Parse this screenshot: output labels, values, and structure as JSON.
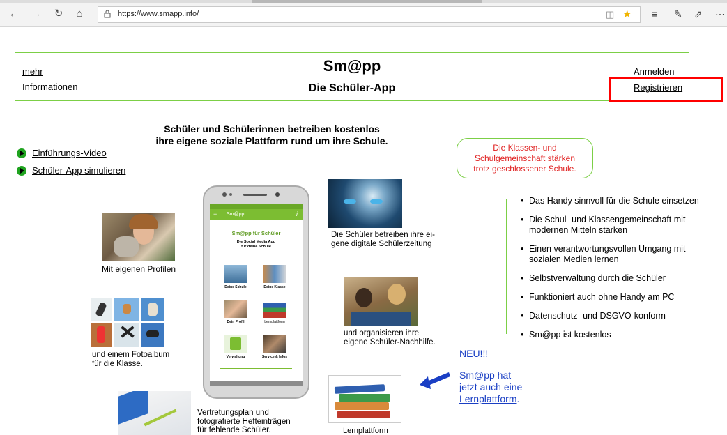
{
  "browser": {
    "url": "https://www.smapp.info/"
  },
  "header": {
    "title": "Sm@pp",
    "subtitle": "Die Schüler-App",
    "left_links": [
      "mehr",
      "Informationen"
    ],
    "login": "Anmelden",
    "register": "Registrieren"
  },
  "intro": {
    "line1": "Schüler und Schülerinnen betreiben kostenlos",
    "line2": "ihre eigene soziale Plattform rund um ihre Schule."
  },
  "side_links": [
    "Einführungs-Video",
    "Schüler-App simulieren"
  ],
  "callout": {
    "line1": "Die Klassen- und",
    "line2": "Schulgemeinschaft stärken",
    "line3": "trotz geschlossener Schule."
  },
  "captions": {
    "profiles": "Mit eigenen Profilen",
    "album1": "und einem Fotoalbum",
    "album2": "für die Klasse.",
    "newspaper1": "Die Schüler betreiben ihre ei-",
    "newspaper2": "gene digitale Schülerzeitung",
    "tutoring1": "und organisieren ihre",
    "tutoring2": "eigene Schüler-Nachhilfe.",
    "plan1": "Vertretungsplan und",
    "plan2": "fotografierte Hefteinträgen",
    "plan3": "für fehlende Schüler.",
    "lernplattform": "Lernplattform"
  },
  "phone": {
    "appbar": "Sm@pp",
    "heading": "Sm@pp für Schüler",
    "sub1": "Die Social Media App",
    "sub2": "für deine Schule",
    "tiles": [
      "Deine Schule",
      "Deine Klasse",
      "Dein Profil",
      "Lernplattform",
      "Verwaltung",
      "Service & Infos"
    ]
  },
  "bullets": [
    "Das Handy sinnvoll für die Schule einsetzen",
    "Die Schul- und Klassengemeinschaft mit modernen Mitteln stärken",
    "Einen verantwortungsvollen Umgang mit sozialen Medien lernen",
    "Selbstverwaltung durch die Schüler",
    "Funktioniert auch ohne Handy am PC",
    "Datenschutz- und DSGVO-konform",
    "Sm@pp ist kostenlos"
  ],
  "news": {
    "tag": "NEU!!!",
    "line1": "Sm@pp hat",
    "line2": "jetzt auch eine",
    "link": "Lernplattform",
    "dot": "."
  },
  "colors": {
    "accent_green": "#7ccf46",
    "callout_red": "#e02020",
    "news_blue": "#1a3fc4",
    "highlight_red": "#ff0000"
  }
}
